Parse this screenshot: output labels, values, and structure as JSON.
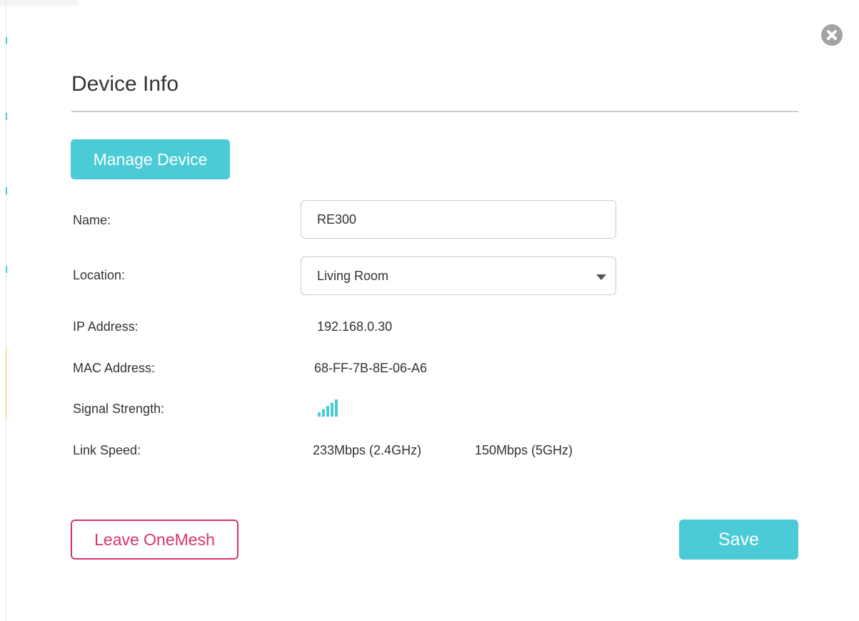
{
  "dialog": {
    "title": "Device Info",
    "close_icon": "close-circle-icon"
  },
  "actions": {
    "manage_device_label": "Manage Device",
    "leave_onemesh_label": "Leave OneMesh",
    "save_label": "Save"
  },
  "fields": {
    "name": {
      "label": "Name:",
      "value": "RE300"
    },
    "location": {
      "label": "Location:",
      "selected": "Living Room"
    },
    "ip_address": {
      "label": "IP Address:",
      "value": "192.168.0.30"
    },
    "mac_address": {
      "label": "MAC Address:",
      "value": "68-FF-7B-8E-06-A6"
    },
    "signal_strength": {
      "label": "Signal Strength:",
      "icon": "signal-bars-icon",
      "level": 5,
      "max_level": 5
    },
    "link_speed": {
      "label": "Link Speed:",
      "speed_24ghz": "233Mbps (2.4GHz)",
      "speed_5ghz": "150Mbps (5GHz)"
    }
  },
  "colors": {
    "accent": "#4acbd6",
    "danger": "#d6336b",
    "close": "#a3a3a3",
    "divider": "#cccccc",
    "text": "#333333"
  }
}
